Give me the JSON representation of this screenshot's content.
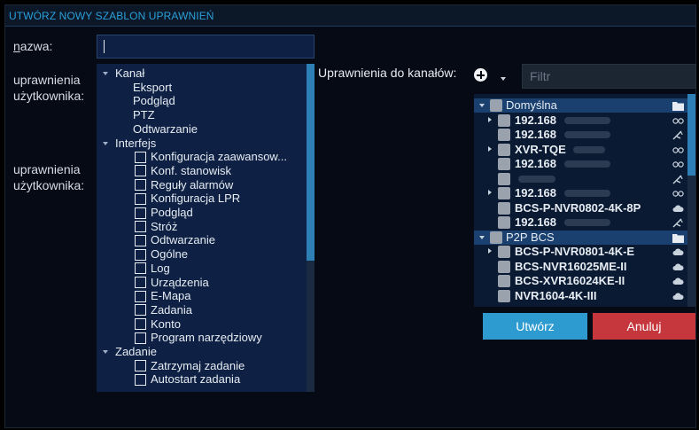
{
  "dialog": {
    "title": "UTWÓRZ NOWY SZABLON UPRAWNIEŃ",
    "name_label_first": "n",
    "name_label_rest": "azwa:",
    "name_value": "",
    "user_perm_label_1": "uprawnienia\nużytkownika:",
    "user_perm_label_2": "uprawnienia\nużytkownika:"
  },
  "tree": [
    {
      "label": "Kanał",
      "level": 0,
      "expanded": true
    },
    {
      "label": "Eksport",
      "level": 1
    },
    {
      "label": "Podgląd",
      "level": 1
    },
    {
      "label": "PTZ",
      "level": 1
    },
    {
      "label": "Odtwarzanie",
      "level": 1
    },
    {
      "label": "Interfejs",
      "level": 0,
      "expanded": true
    },
    {
      "label": "Konfiguracja zaawansow...",
      "level": 1,
      "checkbox": true
    },
    {
      "label": "Konf. stanowisk",
      "level": 1,
      "checkbox": true
    },
    {
      "label": "Reguły alarmów",
      "level": 1,
      "checkbox": true
    },
    {
      "label": "Konfiguracja LPR",
      "level": 1,
      "checkbox": true
    },
    {
      "label": "Podgląd",
      "level": 1,
      "checkbox": true
    },
    {
      "label": "Stróż",
      "level": 1,
      "checkbox": true
    },
    {
      "label": "Odtwarzanie",
      "level": 1,
      "checkbox": true
    },
    {
      "label": "Ogólne",
      "level": 1,
      "checkbox": true
    },
    {
      "label": "Log",
      "level": 1,
      "checkbox": true
    },
    {
      "label": "Urządzenia",
      "level": 1,
      "checkbox": true
    },
    {
      "label": "E-Mapa",
      "level": 1,
      "checkbox": true
    },
    {
      "label": "Zadania",
      "level": 1,
      "checkbox": true
    },
    {
      "label": "Konto",
      "level": 1,
      "checkbox": true
    },
    {
      "label": "Program narzędziowy",
      "level": 1,
      "checkbox": true
    },
    {
      "label": "Zadanie",
      "level": 0,
      "expanded": true
    },
    {
      "label": "Zatrzymaj zadanie",
      "level": 1,
      "checkbox": true
    },
    {
      "label": "Autostart zadania",
      "level": 1,
      "checkbox": true
    }
  ],
  "channels": {
    "label": "Uprawnienia do kanałów:",
    "filter_placeholder": "Filtr",
    "filter_value": "",
    "rows": [
      {
        "type": "group",
        "label": "Domyślna",
        "icon": "folder-icon"
      },
      {
        "type": "device",
        "label": "192.168",
        "expandable": true,
        "icon": "link-icon"
      },
      {
        "type": "device",
        "label": "192.168",
        "expandable": false,
        "icon": "antenna-icon"
      },
      {
        "type": "device",
        "label": "XVR-TQE",
        "expandable": true,
        "icon": "link-icon"
      },
      {
        "type": "device",
        "label": "192.168",
        "expandable": false,
        "icon": "link-icon"
      },
      {
        "type": "device",
        "label": "",
        "expandable": false,
        "icon": "antenna-icon"
      },
      {
        "type": "device",
        "label": "192.168",
        "expandable": true,
        "icon": "link-icon"
      },
      {
        "type": "device",
        "label": "BCS-P-NVR0802-4K-8P",
        "expandable": false,
        "icon": "cloud-icon"
      },
      {
        "type": "device",
        "label": "192.168",
        "expandable": false,
        "icon": "antenna-icon"
      },
      {
        "type": "group",
        "label": "P2P BCS",
        "icon": "folder-icon"
      },
      {
        "type": "device",
        "label": "BCS-P-NVR0801-4K-E",
        "expandable": true,
        "icon": "cloud-icon"
      },
      {
        "type": "device",
        "label": "BCS-NVR16025ME-II",
        "expandable": false,
        "icon": "cloud-icon"
      },
      {
        "type": "device",
        "label": "BCS-XVR16024KE-II",
        "expandable": false,
        "icon": "cloud-icon"
      },
      {
        "type": "device",
        "label": "NVR1604-4K-III",
        "expandable": false,
        "icon": "cloud-icon"
      }
    ]
  },
  "buttons": {
    "create": "Utwórz",
    "cancel": "Anuluj"
  },
  "colors": {
    "accent": "#2e9bd0",
    "danger": "#c5373c",
    "title": "#2aa0d8"
  }
}
